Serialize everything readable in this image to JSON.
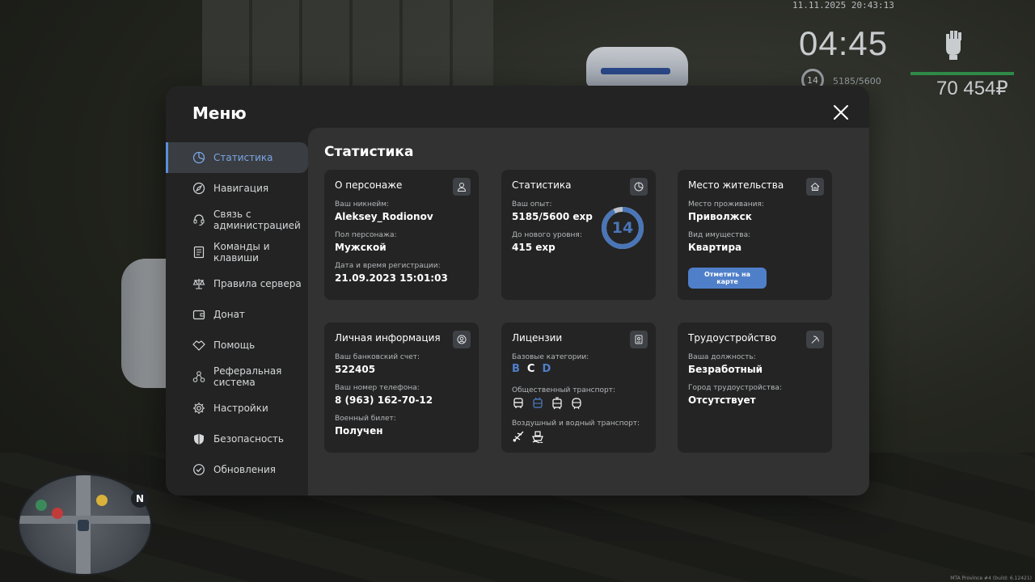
{
  "hud": {
    "datetime": "11.11.2025 20:43:13",
    "clock": "04:45",
    "level": "14",
    "exp": "5185/5600",
    "money": "70 454₽",
    "build": "MTA Province #4 (build: 6.12421)",
    "health_color": "#2f8a49"
  },
  "menu": {
    "title": "Меню",
    "close_icon": "close-icon",
    "sidebar": [
      {
        "label": "Статистика",
        "icon": "stats-icon",
        "active": true
      },
      {
        "label": "Навигация",
        "icon": "compass-icon"
      },
      {
        "label": "Связь с администрацией",
        "icon": "headset-icon"
      },
      {
        "label": "Команды и клавиши",
        "icon": "keyboard-icon"
      },
      {
        "label": "Правила сервера",
        "icon": "scales-icon"
      },
      {
        "label": "Донат",
        "icon": "wallet-icon"
      },
      {
        "label": "Помощь",
        "icon": "handshake-icon"
      },
      {
        "label": "Реферальная система",
        "icon": "network-icon"
      },
      {
        "label": "Настройки",
        "icon": "gear-icon"
      },
      {
        "label": "Безопасность",
        "icon": "shield-icon"
      },
      {
        "label": "Обновления",
        "icon": "refresh-icon"
      }
    ]
  },
  "content": {
    "title": "Статистика",
    "character": {
      "title": "О персонаже",
      "nick_label": "Ваш никнейм:",
      "nick": "Aleksey_Rodionov",
      "gender_label": "Пол персонажа:",
      "gender": "Мужской",
      "reg_label": "Дата и время регистрации:",
      "reg": "21.09.2023 15:01:03"
    },
    "stats": {
      "title": "Статистика",
      "exp_label": "Ваш опыт:",
      "exp": "5185/5600 exp",
      "next_label": "До нового уровня:",
      "next": "415 exp",
      "level": "14",
      "progress": 0.926,
      "ring_color": "#4a76b8"
    },
    "residence": {
      "title": "Место жительства",
      "place_label": "Место проживания:",
      "place": "Приволжск",
      "prop_label": "Вид имущества:",
      "prop": "Квартира",
      "button": "Отметить на карте"
    },
    "personal": {
      "title": "Личная информация",
      "bank_label": "Ваш банковский счет:",
      "bank": "522405",
      "phone_label": "Ваш номер телефона:",
      "phone": "8 (963) 162-70-12",
      "military_label": "Военный билет:",
      "military": "Получен"
    },
    "licenses": {
      "title": "Лицензии",
      "base_label": "Базовые категории:",
      "categories": [
        {
          "name": "B",
          "color": "#4f7fc9"
        },
        {
          "name": "C",
          "color": "#ffffff"
        },
        {
          "name": "D",
          "color": "#4f7fc9"
        }
      ],
      "public_label": "Общественный транспорт:",
      "public_icons": [
        "bus-icon",
        "trolleybus-icon",
        "tram-icon",
        "metro-icon"
      ],
      "air_label": "Воздушный и водный транспорт:",
      "air_icons": [
        "plane-icon",
        "ship-icon"
      ]
    },
    "employment": {
      "title": "Трудоустройство",
      "position_label": "Ваша должность:",
      "position": "Безработный",
      "city_label": "Город трудоустройства:",
      "city": "Отсутствует"
    }
  }
}
